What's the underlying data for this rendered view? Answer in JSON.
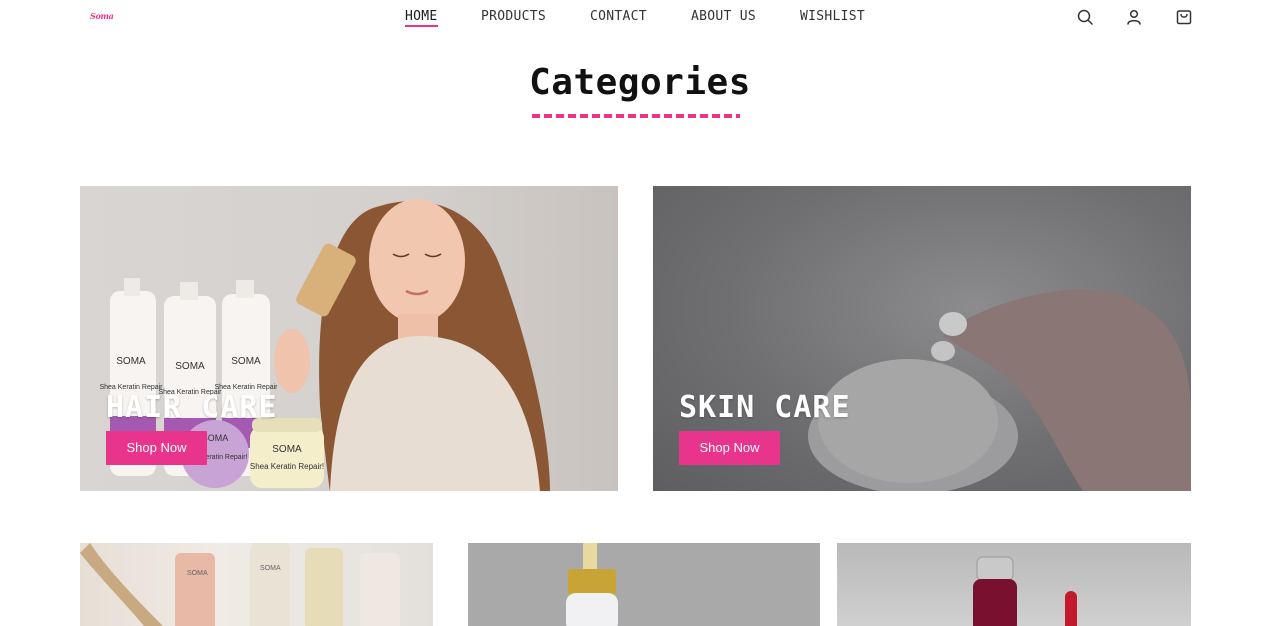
{
  "brand": {
    "logo_text": "Soma",
    "accent": "#e8348a"
  },
  "nav": {
    "items": [
      {
        "label": "HOME",
        "active": true
      },
      {
        "label": "PRODUCTS",
        "active": false
      },
      {
        "label": "CONTACT",
        "active": false
      },
      {
        "label": "ABOUT US",
        "active": false
      },
      {
        "label": "WISHLIST",
        "active": false
      }
    ],
    "icons": [
      "search-icon",
      "user-icon",
      "cart-icon"
    ]
  },
  "section": {
    "title": "Categories"
  },
  "categories": [
    {
      "title": "HAIR CARE",
      "button": "Shop Now",
      "product_labels": [
        "SOMA",
        "Shea Keratin Repair",
        "SOMA",
        "Shea Keratin Repair",
        "SOMA",
        "Shea Keratin Repair",
        "SOMA",
        "Shea Keratin Repair!",
        "SOMA",
        "Shea Keratin Repair!"
      ]
    },
    {
      "title": "SKIN CARE",
      "button": "Shop Now"
    }
  ],
  "more_categories": [
    {
      "product_labels": [
        "SOMA",
        "SOMA"
      ]
    },
    {
      "product_labels": []
    },
    {
      "product_labels": []
    }
  ]
}
